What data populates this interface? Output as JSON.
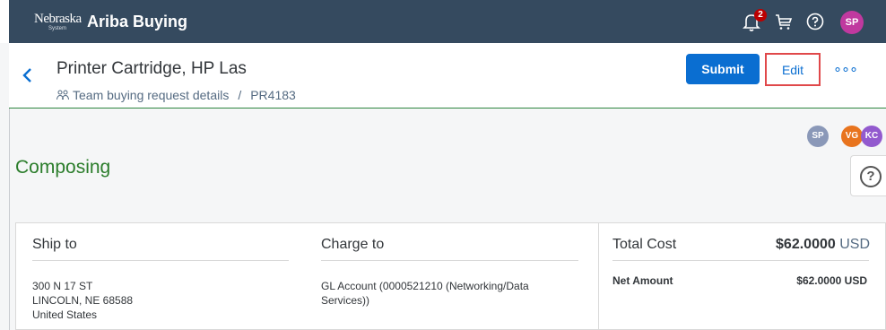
{
  "topbar": {
    "logo_text": "Nebraska",
    "logo_sub": "System",
    "app_title": "Ariba Buying",
    "notification_count": "2",
    "user_initials": "SP"
  },
  "header": {
    "title": "Printer Cartridge, HP Las",
    "breadcrumb_label": "Team buying request details",
    "breadcrumb_sep": "/",
    "request_id": "PR4183",
    "submit_label": "Submit",
    "edit_label": "Edit",
    "more_label": "∘∘∘"
  },
  "status": "Composing",
  "participants": [
    {
      "initials": "SP",
      "color": "#8a98b8"
    },
    {
      "initials": "VG",
      "color": "#e8741e"
    },
    {
      "initials": "KC",
      "color": "#925ace"
    }
  ],
  "help_label": "?",
  "ship_to": {
    "heading": "Ship to",
    "line1": "300 N 17 ST",
    "line2": "LINCOLN, NE  68588",
    "line3": "United States"
  },
  "charge_to": {
    "heading": "Charge to",
    "line1": "GL Account (0000521210 (Networking/Data",
    "line2": "Services))"
  },
  "cost": {
    "heading": "Total Cost",
    "total_amount": "$62.0000",
    "total_currency": "USD",
    "net_label": "Net Amount",
    "net_value": "$62.0000 USD"
  },
  "colors": {
    "shell": "#354a5f",
    "accent": "#0a6ed1",
    "status_green": "#2b7d2b",
    "highlight_box": "#e0484a"
  }
}
